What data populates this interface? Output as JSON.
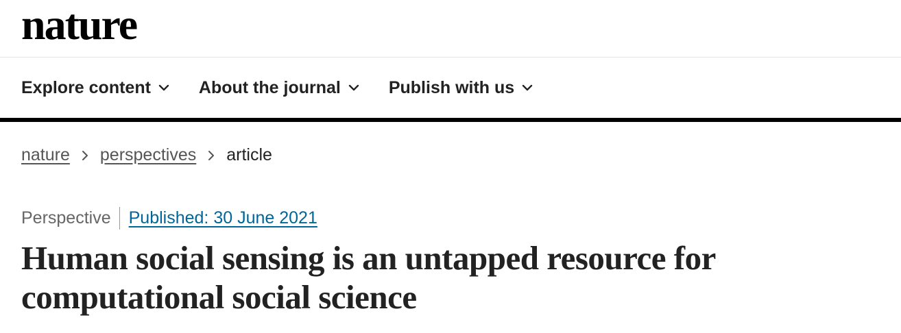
{
  "masthead": {
    "logo_text": "nature"
  },
  "nav": {
    "items": [
      {
        "label": "Explore content",
        "icon": "chevron-down-icon"
      },
      {
        "label": "About the journal",
        "icon": "chevron-down-icon"
      },
      {
        "label": "Publish with us",
        "icon": "chevron-down-icon"
      }
    ]
  },
  "breadcrumb": {
    "items": [
      {
        "label": "nature",
        "link": true
      },
      {
        "label": "perspectives",
        "link": true
      },
      {
        "label": "article",
        "link": false
      }
    ],
    "separator_icon": "chevron-right-icon"
  },
  "article": {
    "type": "Perspective",
    "published": "Published: 30 June 2021",
    "title": "Human social sensing is an untapped resource for computational social science"
  },
  "colors": {
    "text": "#222222",
    "link_blue": "#006699",
    "breadcrumb_link": "#555555",
    "nav_rule": "#000000"
  }
}
